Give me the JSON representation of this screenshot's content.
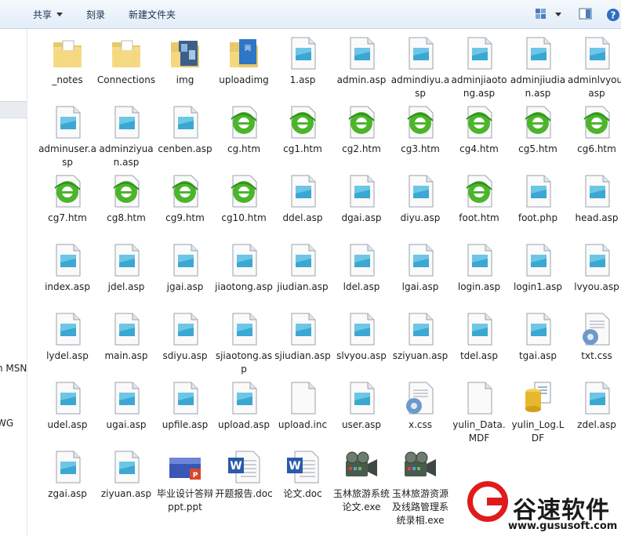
{
  "toolbar": {
    "share": "共享",
    "burn": "刻录",
    "new_folder": "新建文件夹"
  },
  "nav": {
    "item1": "n MSN",
    "item2": "WG"
  },
  "files": [
    {
      "name": "_notes",
      "type": "folder"
    },
    {
      "name": "Connections",
      "type": "folder"
    },
    {
      "name": "img",
      "type": "folder-img"
    },
    {
      "name": "uploadimg",
      "type": "folder-blue"
    },
    {
      "name": "1.asp",
      "type": "asp"
    },
    {
      "name": "admin.asp",
      "type": "asp"
    },
    {
      "name": "admindiyu.asp",
      "type": "asp"
    },
    {
      "name": "adminjiaotong.asp",
      "type": "asp"
    },
    {
      "name": "adminjiudian.asp",
      "type": "asp"
    },
    {
      "name": "adminlvyou.asp",
      "type": "asp"
    },
    {
      "name": "adminuser.asp",
      "type": "asp"
    },
    {
      "name": "adminziyuan.asp",
      "type": "asp"
    },
    {
      "name": "cenben.asp",
      "type": "asp"
    },
    {
      "name": "cg.htm",
      "type": "htm"
    },
    {
      "name": "cg1.htm",
      "type": "htm"
    },
    {
      "name": "cg2.htm",
      "type": "htm"
    },
    {
      "name": "cg3.htm",
      "type": "htm"
    },
    {
      "name": "cg4.htm",
      "type": "htm"
    },
    {
      "name": "cg5.htm",
      "type": "htm"
    },
    {
      "name": "cg6.htm",
      "type": "htm"
    },
    {
      "name": "cg7.htm",
      "type": "htm"
    },
    {
      "name": "cg8.htm",
      "type": "htm"
    },
    {
      "name": "cg9.htm",
      "type": "htm"
    },
    {
      "name": "cg10.htm",
      "type": "htm"
    },
    {
      "name": "ddel.asp",
      "type": "asp"
    },
    {
      "name": "dgai.asp",
      "type": "asp"
    },
    {
      "name": "diyu.asp",
      "type": "asp"
    },
    {
      "name": "foot.htm",
      "type": "htm"
    },
    {
      "name": "foot.php",
      "type": "asp"
    },
    {
      "name": "head.asp",
      "type": "asp"
    },
    {
      "name": "index.asp",
      "type": "asp"
    },
    {
      "name": "jdel.asp",
      "type": "asp"
    },
    {
      "name": "jgai.asp",
      "type": "asp"
    },
    {
      "name": "jiaotong.asp",
      "type": "asp"
    },
    {
      "name": "jiudian.asp",
      "type": "asp"
    },
    {
      "name": "ldel.asp",
      "type": "asp"
    },
    {
      "name": "lgai.asp",
      "type": "asp"
    },
    {
      "name": "login.asp",
      "type": "asp"
    },
    {
      "name": "login1.asp",
      "type": "asp"
    },
    {
      "name": "lvyou.asp",
      "type": "asp"
    },
    {
      "name": "lydel.asp",
      "type": "asp"
    },
    {
      "name": "main.asp",
      "type": "asp"
    },
    {
      "name": "sdiyu.asp",
      "type": "asp"
    },
    {
      "name": "sjiaotong.asp",
      "type": "asp"
    },
    {
      "name": "sjiudian.asp",
      "type": "asp"
    },
    {
      "name": "slvyou.asp",
      "type": "asp"
    },
    {
      "name": "sziyuan.asp",
      "type": "asp"
    },
    {
      "name": "tdel.asp",
      "type": "asp"
    },
    {
      "name": "tgai.asp",
      "type": "asp"
    },
    {
      "name": "txt.css",
      "type": "css"
    },
    {
      "name": "udel.asp",
      "type": "asp"
    },
    {
      "name": "ugai.asp",
      "type": "asp"
    },
    {
      "name": "upfile.asp",
      "type": "asp"
    },
    {
      "name": "upload.asp",
      "type": "asp"
    },
    {
      "name": "upload.inc",
      "type": "blank"
    },
    {
      "name": "user.asp",
      "type": "asp"
    },
    {
      "name": "x.css",
      "type": "css"
    },
    {
      "name": "yulin_Data.MDF",
      "type": "blank"
    },
    {
      "name": "yulin_Log.LDF",
      "type": "db"
    },
    {
      "name": "zdel.asp",
      "type": "asp"
    },
    {
      "name": "zgai.asp",
      "type": "asp"
    },
    {
      "name": "ziyuan.asp",
      "type": "asp"
    },
    {
      "name": "毕业设计答辩ppt.ppt",
      "type": "ppt"
    },
    {
      "name": "开题报告.doc",
      "type": "doc"
    },
    {
      "name": "论文.doc",
      "type": "doc"
    },
    {
      "name": "玉林旅游系统论文.exe",
      "type": "exe"
    },
    {
      "name": "玉林旅游资源及线路管理系统录相.exe",
      "type": "exe"
    }
  ],
  "watermark": {
    "brand": "谷速软件",
    "url": "www.gususoft.com"
  }
}
